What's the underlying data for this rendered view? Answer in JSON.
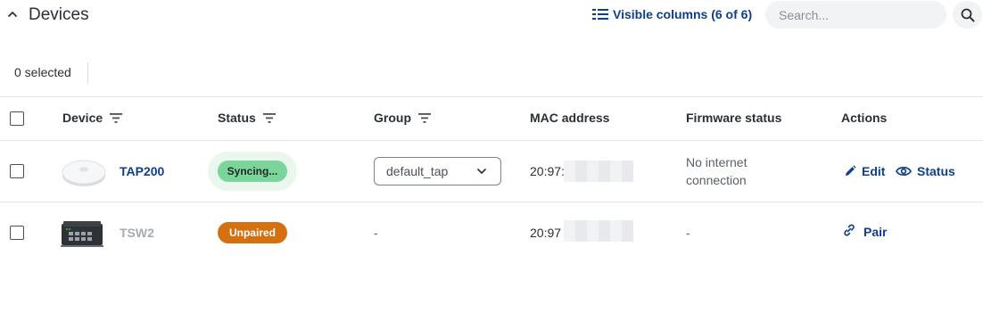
{
  "header": {
    "title": "Devices",
    "visible_columns_label": "Visible columns (6 of 6)",
    "search_placeholder": "Search..."
  },
  "selection": {
    "count_label": "0 selected"
  },
  "table": {
    "columns": [
      "Device",
      "Status",
      "Group",
      "MAC address",
      "Firmware status",
      "Actions"
    ],
    "rows": [
      {
        "device": "TAP200",
        "status": "Syncing...",
        "group": "default_tap",
        "mac_prefix": "20:97:",
        "firmware_line1": "No internet",
        "firmware_line2": "connection",
        "actions": [
          "Edit",
          "Status"
        ]
      },
      {
        "device": "TSW2",
        "status": "Unpaired",
        "group": "-",
        "mac_prefix": "20:97",
        "firmware": "-",
        "actions": [
          "Pair"
        ]
      }
    ]
  },
  "colors": {
    "link": "#0f3f8c",
    "syncing_badge": "#7bd49a",
    "unpaired_badge": "#d4700f",
    "muted_text": "#a7abb2"
  }
}
